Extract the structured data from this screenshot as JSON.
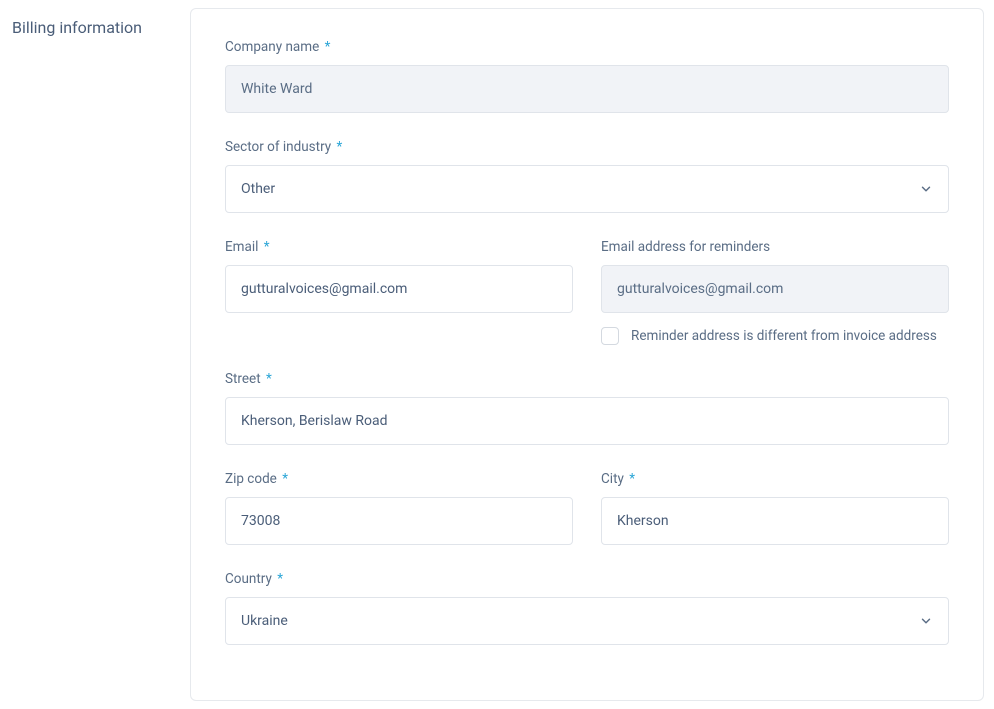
{
  "section_title": "Billing information",
  "fields": {
    "company_name": {
      "label": "Company name",
      "required_mark": "*",
      "value": "White Ward"
    },
    "sector": {
      "label": "Sector of industry",
      "required_mark": "*",
      "value": "Other"
    },
    "email": {
      "label": "Email",
      "required_mark": "*",
      "value": "gutturalvoices@gmail.com"
    },
    "reminder_email": {
      "label": "Email address for reminders",
      "value": "gutturalvoices@gmail.com",
      "checkbox_label": "Reminder address is different from invoice address"
    },
    "street": {
      "label": "Street",
      "required_mark": "*",
      "value": "Kherson, Berislaw Road"
    },
    "zip": {
      "label": "Zip code",
      "required_mark": "*",
      "value": "73008"
    },
    "city": {
      "label": "City",
      "required_mark": "*",
      "value": "Kherson"
    },
    "country": {
      "label": "Country",
      "required_mark": "*",
      "value": "Ukraine"
    }
  }
}
